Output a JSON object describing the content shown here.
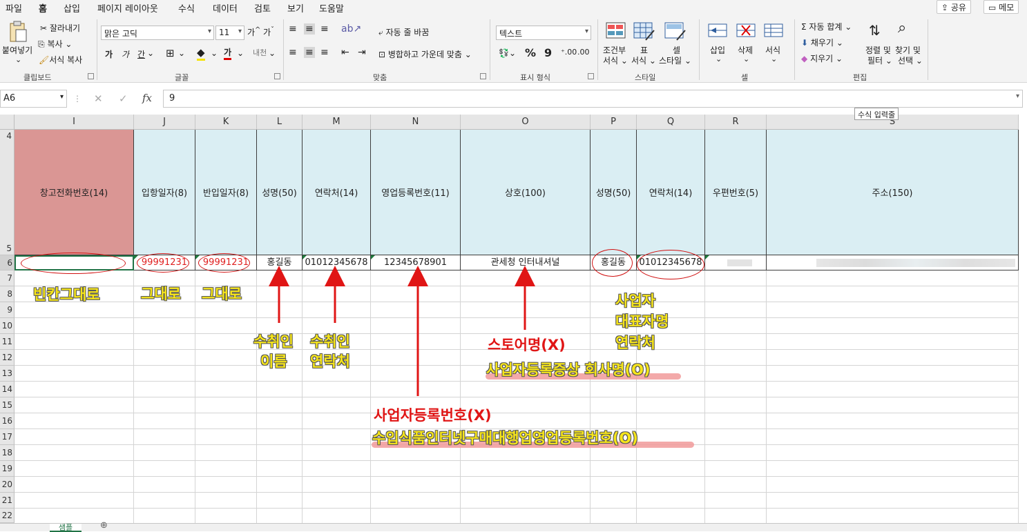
{
  "menu": {
    "tabs": [
      "파일",
      "홈",
      "삽입",
      "페이지 레이아웃",
      "수식",
      "데이터",
      "검토",
      "보기",
      "도움말"
    ],
    "share": "공유",
    "memo": "메모"
  },
  "ribbon": {
    "clipboard": {
      "paste": "붙여넣기",
      "cut": "잘라내기",
      "copy": "복사",
      "format_painter": "서식 복사",
      "label": "클립보드"
    },
    "font": {
      "name": "맑은 고딕",
      "size": "11",
      "bold": "가",
      "italic": "가",
      "underline": "간",
      "label": "글꼴"
    },
    "alignment": {
      "wrap_text": "자동 줄 바꿈",
      "merge_center": "병합하고 가운데 맞춤",
      "label": "맞춤"
    },
    "number": {
      "format": "텍스트",
      "label": "표시 형식"
    },
    "styles": {
      "conditional_1": "조건부",
      "conditional_2": "서식",
      "table_1": "표",
      "table_2": "서식",
      "cell_1": "셀",
      "cell_2": "스타일",
      "label": "스타일"
    },
    "cells": {
      "insert": "삽입",
      "delete": "삭제",
      "format": "서식",
      "label": "셀"
    },
    "editing": {
      "autosum": "자동 합계",
      "fill": "채우기",
      "clear": "지우기",
      "sort_1": "정렬 및",
      "sort_2": "필터",
      "find_1": "찾기 및",
      "find_2": "선택",
      "label": "편집"
    }
  },
  "formula_bar": {
    "name_box": "A6",
    "fx": "fx",
    "value": "9",
    "tooltip": "수식 입력줄"
  },
  "columns": [
    "I",
    "J",
    "K",
    "L",
    "M",
    "N",
    "O",
    "P",
    "Q",
    "R",
    "S"
  ],
  "rows": [
    "4",
    "5",
    "6",
    "7",
    "8",
    "9",
    "10",
    "11",
    "12",
    "13",
    "14",
    "15",
    "16",
    "17",
    "18",
    "19",
    "20",
    "21",
    "22"
  ],
  "header_cells": [
    "창고전화번호(14)",
    "입항일자(8)",
    "반입일자(8)",
    "성명(50)",
    "연락처(14)",
    "영업등록번호(11)",
    "상호(100)",
    "성명(50)",
    "연락처(14)",
    "우편번호(5)",
    "주소(150)"
  ],
  "data_row": [
    "",
    "99991231",
    "99991231",
    "홍길동",
    "01012345678",
    "12345678901",
    "관세청 인터내셔널",
    "홍길동",
    "01012345678",
    "",
    ""
  ],
  "annotations": {
    "blank": "빈칸그대로",
    "same1": "그대로",
    "same2": "그대로",
    "recipient_name_1": "수취인",
    "recipient_name_2": "이름",
    "recipient_contact_1": "수취인",
    "recipient_contact_2": "연락처",
    "store_name_x": "스토어명(X)",
    "company_name_o": "사업자등록증상 회사명(O)",
    "rep_1": "사업자",
    "rep_2": "대표자명",
    "rep_3": "연락처",
    "bizno_x": "사업자등록번호(X)",
    "importno_o": "수입식품인터넷구매대행업영업등록번호(O)"
  },
  "sheet_tab": "샘플",
  "colors": {
    "header_blue": "#daeef3",
    "header_pink": "#da9694",
    "annotation_yellow": "#f6e51b",
    "annotation_red": "#e01515",
    "highlight": "#f19a9a",
    "excel_green": "#217346"
  }
}
